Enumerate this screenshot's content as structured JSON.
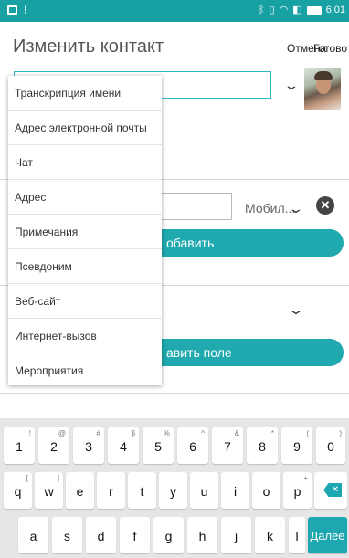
{
  "status_bar": {
    "notification_icon": "square-icon",
    "alert": "!",
    "time": "6:01",
    "icons": [
      "bluetooth-icon",
      "vibrate-icon",
      "wifi-icon",
      "battery-saver-icon",
      "battery-icon"
    ]
  },
  "header": {
    "title": "Изменить контакт",
    "cancel": "Отмена",
    "done": "Готово"
  },
  "form": {
    "phone_type": "Мобил...",
    "add_button": "обавить",
    "add_field_button": "авить поле"
  },
  "menu": {
    "items": [
      "Транскрипция имени",
      "Адрес электронной почты",
      "Чат",
      "Адрес",
      "Примечания",
      "Псевдоним",
      "Веб-сайт",
      "Интернет-вызов",
      "Мероприятия"
    ]
  },
  "keyboard": {
    "row1": [
      {
        "main": "1",
        "alt": "!"
      },
      {
        "main": "2",
        "alt": "@"
      },
      {
        "main": "3",
        "alt": "#"
      },
      {
        "main": "4",
        "alt": "$"
      },
      {
        "main": "5",
        "alt": "%"
      },
      {
        "main": "6",
        "alt": "^"
      },
      {
        "main": "7",
        "alt": "&"
      },
      {
        "main": "8",
        "alt": "*"
      },
      {
        "main": "9",
        "alt": "("
      },
      {
        "main": "0",
        "alt": ")"
      }
    ],
    "row2": [
      {
        "main": "q",
        "alt": "["
      },
      {
        "main": "w",
        "alt": "]"
      },
      {
        "main": "e",
        "alt": ""
      },
      {
        "main": "r",
        "alt": ""
      },
      {
        "main": "t",
        "alt": ""
      },
      {
        "main": "y",
        "alt": ""
      },
      {
        "main": "u",
        "alt": ""
      },
      {
        "main": "i",
        "alt": ""
      },
      {
        "main": "o",
        "alt": ""
      },
      {
        "main": "p",
        "alt": "+"
      }
    ],
    "row3": [
      {
        "main": "a",
        "alt": ""
      },
      {
        "main": "s",
        "alt": ""
      },
      {
        "main": "d",
        "alt": ""
      },
      {
        "main": "f",
        "alt": ""
      },
      {
        "main": "g",
        "alt": ""
      },
      {
        "main": "h",
        "alt": ""
      },
      {
        "main": "j",
        "alt": ""
      },
      {
        "main": "k",
        "alt": ":"
      },
      {
        "main": "l",
        "alt": ""
      }
    ],
    "backspace_symbol": "✕",
    "enter_label": "Далее"
  },
  "colors": {
    "accent": "#20a9af",
    "status_bar": "#17a1a3"
  }
}
